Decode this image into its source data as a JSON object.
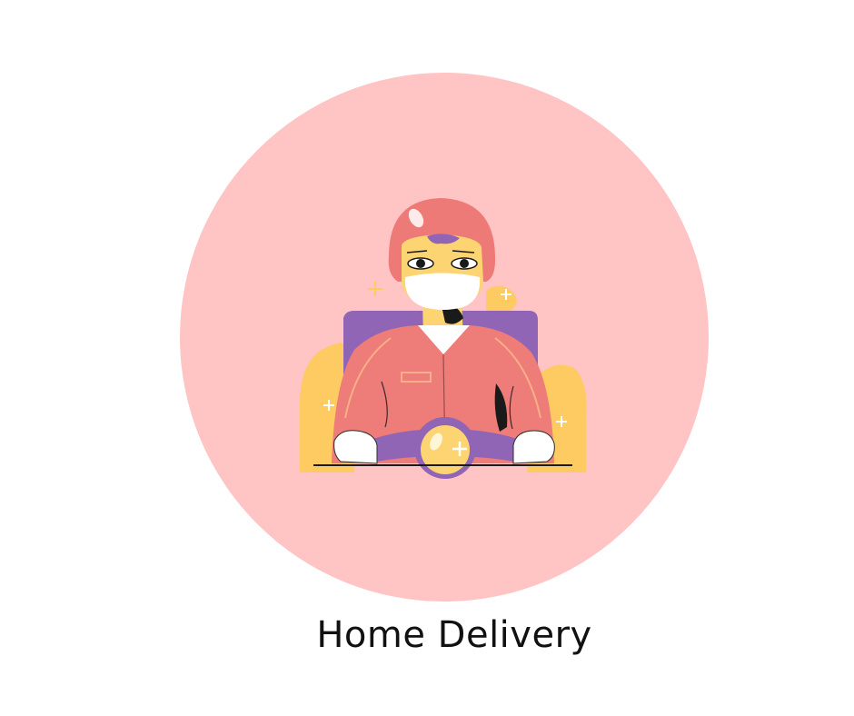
{
  "title": "Home Delivery",
  "colors": {
    "circle": "#ffc4c3",
    "helmet": "#ee7a78",
    "jacket": "#ee7c78",
    "accent_yellow": "#fdcb62",
    "accent_purple": "#9165b5",
    "skin": "#fdd472"
  },
  "illustration": {
    "subject": "delivery-rider-icon"
  }
}
